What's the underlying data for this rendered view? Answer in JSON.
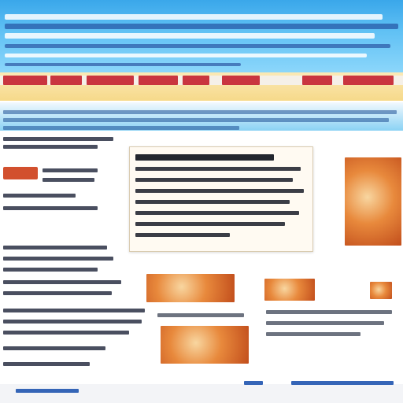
{
  "header": {
    "site_title": "",
    "lines": 5
  },
  "nav": {
    "tabs": [
      "",
      "",
      "",
      "",
      "",
      "",
      "",
      ""
    ]
  },
  "sidebar": {
    "badge": "",
    "items": [
      "",
      "",
      "",
      "",
      "",
      "",
      "",
      "",
      ""
    ]
  },
  "article": {
    "title": "",
    "lines": 8
  },
  "images": [
    "",
    "",
    "",
    "",
    "",
    ""
  ],
  "footer": {
    "links": [
      "",
      "",
      ""
    ]
  },
  "colors": {
    "header": "#3aa7ea",
    "nav_tab": "#c9353f",
    "accent_orange": "#e8893c",
    "link": "#3565b7"
  }
}
